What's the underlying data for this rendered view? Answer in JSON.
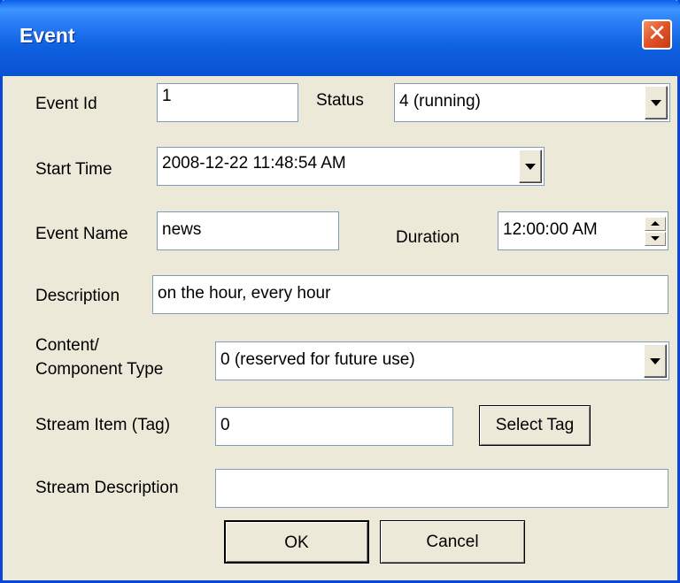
{
  "window": {
    "title": "Event",
    "close_symbol": "✕"
  },
  "form": {
    "event_id": {
      "label": "Event Id",
      "value": "1"
    },
    "status": {
      "label": "Status",
      "value": "4 (running)"
    },
    "start_time": {
      "label": "Start Time",
      "value": "2008-12-22  11:48:54 AM"
    },
    "event_name": {
      "label": "Event Name",
      "value": "news"
    },
    "duration": {
      "label": "Duration",
      "value": "12:00:00 AM"
    },
    "description": {
      "label": "Description",
      "value": "on the hour, every hour"
    },
    "content_type": {
      "label_line1": "Content/",
      "label_line2": "Component Type",
      "value": "0 (reserved for future use)"
    },
    "stream_item": {
      "label": "Stream Item (Tag)",
      "value": "0"
    },
    "select_tag": {
      "label": "Select Tag"
    },
    "stream_description": {
      "label": "Stream Description",
      "value": ""
    }
  },
  "buttons": {
    "ok": "OK",
    "cancel": "Cancel"
  },
  "colors": {
    "titlebar": "#0a5fe8",
    "dialog_bg": "#ece9d8",
    "close": "#e2552a",
    "field_border": "#7f9db9"
  }
}
